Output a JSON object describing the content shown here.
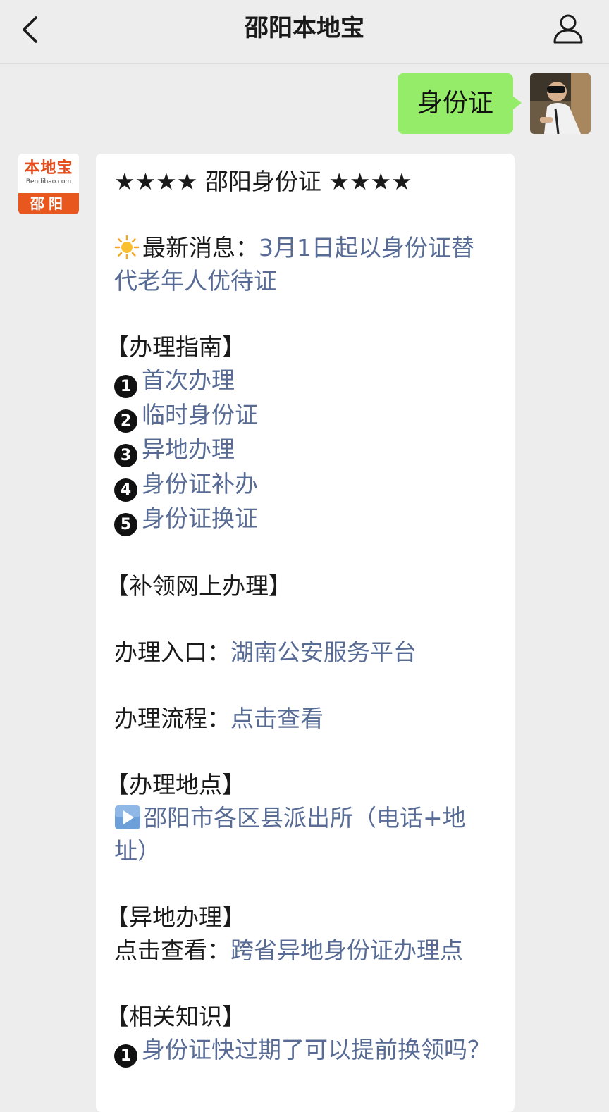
{
  "header": {
    "title": "邵阳本地宝",
    "back_icon": "chevron-left-icon",
    "profile_icon": "user-icon"
  },
  "user_message": {
    "text": "身份证",
    "bubble_color": "#95ec69"
  },
  "bot_avatar": {
    "logo_main": "本地宝",
    "logo_sub": "Bendibao.com",
    "logo_city": "邵阳",
    "brand_color": "#e8581e"
  },
  "bot_message": {
    "link_color": "#576b95",
    "heading": "★★★★ 邵阳身份证 ★★★★",
    "news_label": "最新消息：",
    "news_link": "3月1日起以身份证替代老年人优待证",
    "guide_heading": "【办理指南】",
    "guide_items": [
      {
        "num": "1",
        "label": "首次办理"
      },
      {
        "num": "2",
        "label": "临时身份证"
      },
      {
        "num": "3",
        "label": "异地办理"
      },
      {
        "num": "4",
        "label": "身份证补办"
      },
      {
        "num": "5",
        "label": "身份证换证"
      }
    ],
    "online_heading": "【补领网上办理】",
    "entry_label": "办理入口：",
    "entry_link": "湖南公安服务平台",
    "process_label": "办理流程：",
    "process_link": "点击查看",
    "location_heading": "【办理地点】",
    "location_link": "邵阳市各区县派出所（电话+地址）",
    "remote_heading": "【异地办理】",
    "remote_label": "点击查看：",
    "remote_link": "跨省异地身份证办理点",
    "knowledge_heading": "【相关知识】",
    "knowledge_items": [
      {
        "num": "1",
        "label": "身份证快过期了可以提前换领吗？"
      }
    ]
  }
}
